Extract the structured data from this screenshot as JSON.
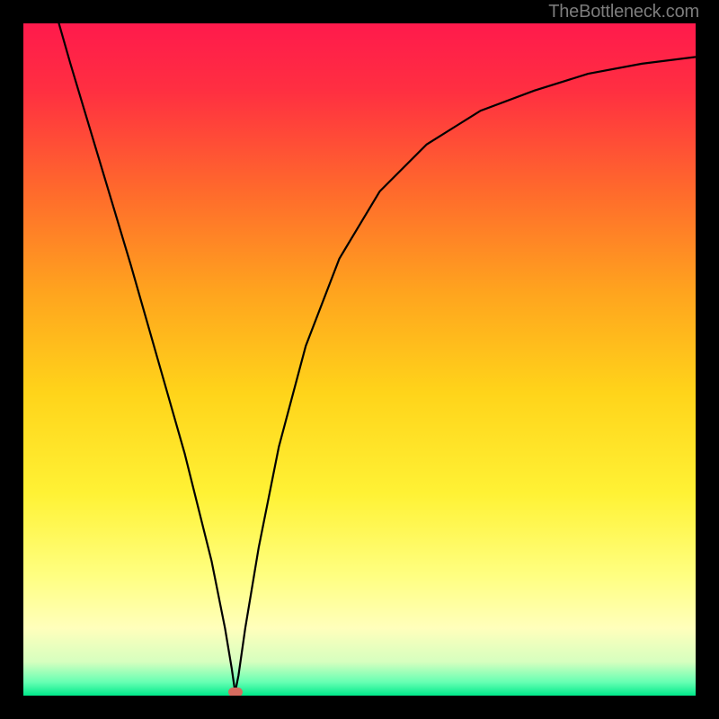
{
  "attribution": "TheBottleneck.com",
  "chart_data": {
    "type": "line",
    "title": "",
    "xlabel": "",
    "ylabel": "",
    "xlim": [
      0,
      100
    ],
    "ylim": [
      0,
      100
    ],
    "x": [
      0,
      3,
      5,
      7,
      10,
      13,
      16,
      20,
      24,
      28,
      30,
      31,
      31.5,
      32,
      33,
      35,
      38,
      42,
      47,
      53,
      60,
      68,
      76,
      84,
      92,
      100
    ],
    "values": [
      118,
      108,
      101,
      94,
      84,
      74,
      64,
      50,
      36,
      20,
      10,
      4,
      0.5,
      3,
      10,
      22,
      37,
      52,
      65,
      75,
      82,
      87,
      90,
      92.5,
      94,
      95
    ],
    "series_name": "bottleneck-curve",
    "marker": {
      "x": 31.5,
      "y": 0.5,
      "color": "#d66b5f"
    },
    "gradient_stops": [
      {
        "pos": 0.0,
        "color": "#ff1a4c"
      },
      {
        "pos": 0.1,
        "color": "#ff2f41"
      },
      {
        "pos": 0.25,
        "color": "#ff6a2c"
      },
      {
        "pos": 0.4,
        "color": "#ffa41e"
      },
      {
        "pos": 0.55,
        "color": "#ffd41a"
      },
      {
        "pos": 0.7,
        "color": "#fff235"
      },
      {
        "pos": 0.82,
        "color": "#ffff80"
      },
      {
        "pos": 0.9,
        "color": "#ffffbc"
      },
      {
        "pos": 0.95,
        "color": "#d6ffbf"
      },
      {
        "pos": 0.98,
        "color": "#66ffb3"
      },
      {
        "pos": 1.0,
        "color": "#00e98a"
      }
    ]
  },
  "colors": {
    "frame": "#000000",
    "curve": "#000000",
    "marker": "#d66b5f",
    "attribution": "#7c7c7c"
  }
}
